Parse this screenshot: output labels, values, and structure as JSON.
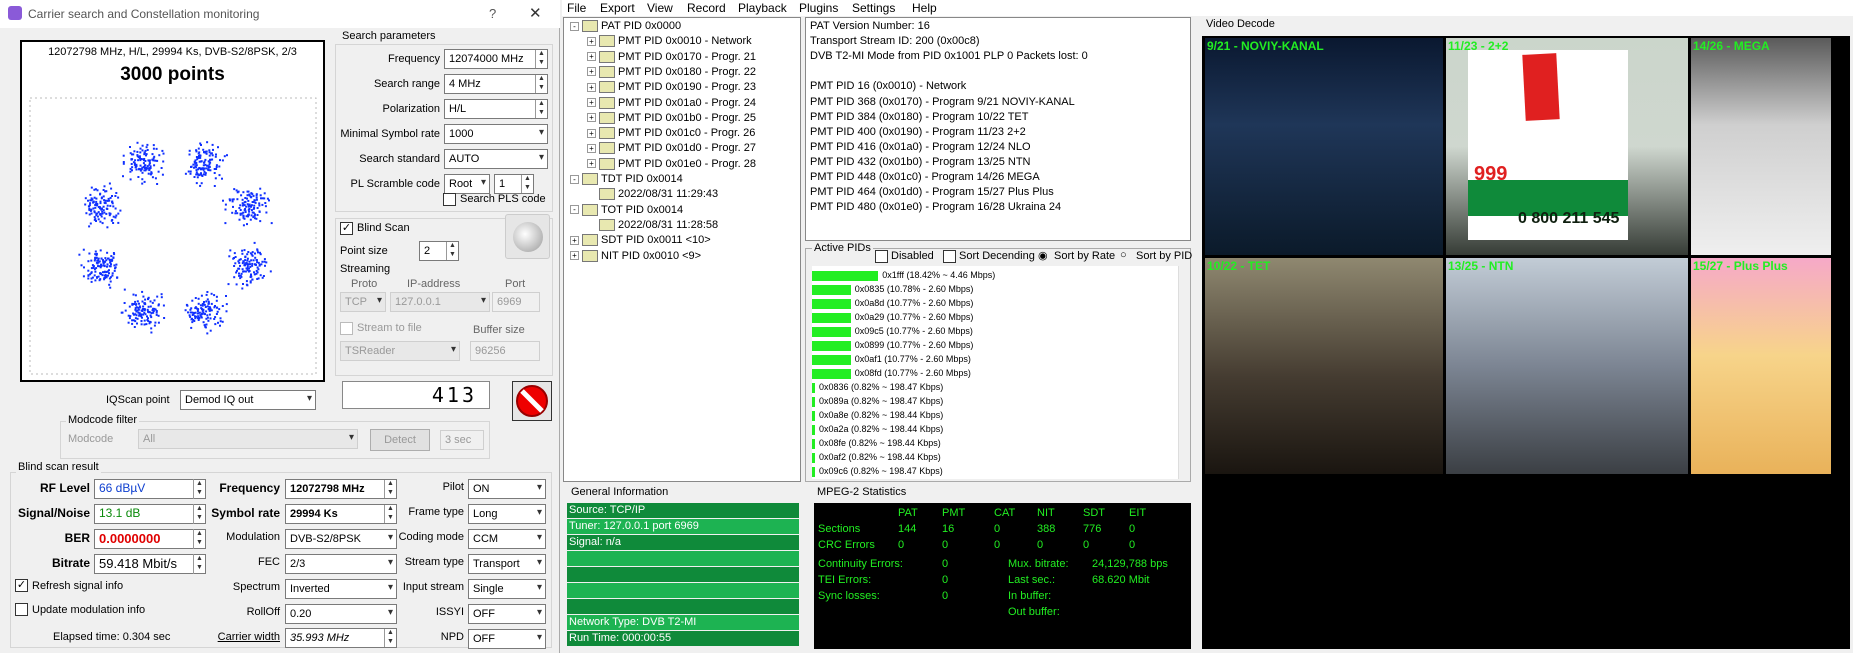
{
  "dialog": {
    "title": "Carrier search and Constellation monitoring",
    "help_glyph": "?",
    "close_glyph": "✕",
    "constellation": {
      "header": "12072798 MHz, H/L, 29994 Ks, DVB-S2/8PSK, 2/3",
      "points_label": "3000 points"
    },
    "search_params": {
      "group": "Search parameters",
      "frequency_label": "Frequency",
      "frequency": "12074000 MHz",
      "range_label": "Search range",
      "range": "4 MHz",
      "polarization_label": "Polarization",
      "polarization": "H/L",
      "min_sr_label": "Minimal Symbol rate",
      "min_sr": "1000",
      "standard_label": "Search standard",
      "standard": "AUTO",
      "pls_label": "PL Scramble code",
      "pls_mode": "Root",
      "pls_value": "1",
      "search_pls": "Search PLS code"
    },
    "blind_scan": "Blind Scan",
    "point_size_label": "Point size",
    "point_size": "2",
    "streaming": {
      "group": "Streaming",
      "proto_label": "Proto",
      "ip_label": "IP-address",
      "port_label": "Port",
      "proto": "TCP",
      "ip": "127.0.0.1",
      "port": "6969",
      "stream_to_file": "Stream to file",
      "buffer_label": "Buffer size",
      "reader": "TSReader",
      "buffer": "96256"
    },
    "counter": "413",
    "iqscan_label": "IQScan point",
    "iqscan": "Demod IQ out",
    "modcode": {
      "group": "Modcode filter",
      "label": "Modcode",
      "value": "All",
      "detect": "Detect",
      "sec": "3 sec"
    },
    "result": {
      "group": "Blind scan result",
      "rf_label": "RF Level",
      "rf": "66 dBµV",
      "sn_label": "Signal/Noise",
      "sn": "13.1 dB",
      "ber_label": "BER",
      "ber": "0.0000000",
      "bitrate_label": "Bitrate",
      "bitrate": "59.418 Mbit/s",
      "freq_label": "Frequency",
      "freq": "12072798 MHz",
      "sr_label": "Symbol rate",
      "sr": "29994 Ks",
      "mod_label": "Modulation",
      "mod": "DVB-S2/8PSK",
      "fec_label": "FEC",
      "fec": "2/3",
      "spectrum_label": "Spectrum",
      "spectrum": "Inverted",
      "rolloff_label": "RollOff",
      "rolloff": "0.20",
      "cw_label": "Carrier width",
      "cw": "35.993 MHz",
      "pilot_label": "Pilot",
      "pilot": "ON",
      "frame_label": "Frame type",
      "frame": "Long",
      "coding_label": "Coding mode",
      "coding": "CCM",
      "stype_label": "Stream type",
      "stype": "Transport",
      "istream_label": "Input stream",
      "istream": "Single",
      "issyi_label": "ISSYI",
      "issyi": "OFF",
      "npd_label": "NPD",
      "npd": "OFF",
      "refresh": "Refresh signal info",
      "update_mod": "Update modulation info",
      "elapsed": "Elapsed time: 0.304 sec"
    }
  },
  "menu": [
    "File",
    "Export",
    "View",
    "Record",
    "Playback",
    "Plugins",
    "Settings",
    "Help"
  ],
  "tree": [
    {
      "t": "PAT PID 0x0000",
      "lvl": 0,
      "exp": "-"
    },
    {
      "t": "PMT PID 0x0010 - Network",
      "lvl": 1,
      "exp": "+"
    },
    {
      "t": "PMT PID 0x0170 - Progr. 21",
      "lvl": 1,
      "exp": "+"
    },
    {
      "t": "PMT PID 0x0180 - Progr. 22",
      "lvl": 1,
      "exp": "+"
    },
    {
      "t": "PMT PID 0x0190 - Progr. 23",
      "lvl": 1,
      "exp": "+"
    },
    {
      "t": "PMT PID 0x01a0 - Progr. 24",
      "lvl": 1,
      "exp": "+"
    },
    {
      "t": "PMT PID 0x01b0 - Progr. 25",
      "lvl": 1,
      "exp": "+"
    },
    {
      "t": "PMT PID 0x01c0 - Progr. 26",
      "lvl": 1,
      "exp": "+"
    },
    {
      "t": "PMT PID 0x01d0 - Progr. 27",
      "lvl": 1,
      "exp": "+"
    },
    {
      "t": "PMT PID 0x01e0 - Progr. 28",
      "lvl": 1,
      "exp": "+"
    },
    {
      "t": "TDT PID 0x0014",
      "lvl": 0,
      "exp": "-"
    },
    {
      "t": "2022/08/31 11:29:43",
      "lvl": 1,
      "exp": ""
    },
    {
      "t": "TOT PID 0x0014",
      "lvl": 0,
      "exp": "-"
    },
    {
      "t": "2022/08/31 11:28:58",
      "lvl": 1,
      "exp": ""
    },
    {
      "t": "SDT PID 0x0011 <10>",
      "lvl": 0,
      "exp": "+"
    },
    {
      "t": "NIT PID 0x0010 <9>",
      "lvl": 0,
      "exp": "+"
    }
  ],
  "info_lines": [
    "PAT Version Number: 16",
    "Transport Stream ID: 200 (0x00c8)",
    "DVB T2-MI Mode from PID 0x1001 PLP 0 Packets lost: 0",
    "",
    "PMT PID 16 (0x0010) - Network",
    "PMT PID 368 (0x0170) - Program 9/21 NOVIY-KANAL",
    "PMT PID 384 (0x0180) - Program 10/22 TET",
    "PMT PID 400 (0x0190) - Program 11/23 2+2",
    "PMT PID 416 (0x01a0) - Program 12/24 NLO",
    "PMT PID 432 (0x01b0) - Program 13/25 NTN",
    "PMT PID 448 (0x01c0) - Program 14/26 MEGA",
    "PMT PID 464 (0x01d0) - Program 15/27 Plus Plus",
    "PMT PID 480 (0x01e0) - Program 16/28 Ukraina 24"
  ],
  "active_pids": {
    "group": "Active PIDs",
    "disabled": "Disabled",
    "sort_desc": "Sort Decending",
    "sort_rate": "Sort by Rate",
    "sort_pid": "Sort by PID",
    "rows": [
      {
        "t": "0x1fff (18.42% ~ 4.46 Mbps)",
        "pct": 18.42
      },
      {
        "t": "0x0835 (10.78% - 2.60 Mbps)",
        "pct": 10.78
      },
      {
        "t": "0x0a8d (10.77% - 2.60 Mbps)",
        "pct": 10.77
      },
      {
        "t": "0x0a29 (10.77% - 2.60 Mbps)",
        "pct": 10.77
      },
      {
        "t": "0x09c5 (10.77% - 2.60 Mbps)",
        "pct": 10.77
      },
      {
        "t": "0x0899 (10.77% - 2.60 Mbps)",
        "pct": 10.77
      },
      {
        "t": "0x0af1 (10.77% - 2.60 Mbps)",
        "pct": 10.77
      },
      {
        "t": "0x08fd (10.77% - 2.60 Mbps)",
        "pct": 10.77
      },
      {
        "t": "0x0836 (0.82% ~ 198.47 Kbps)",
        "pct": 0.82
      },
      {
        "t": "0x089a (0.82% ~ 198.47 Kbps)",
        "pct": 0.82
      },
      {
        "t": "0x0a8e (0.82% ~ 198.44 Kbps)",
        "pct": 0.82
      },
      {
        "t": "0x0a2a (0.82% ~ 198.44 Kbps)",
        "pct": 0.82
      },
      {
        "t": "0x08fe (0.82% ~ 198.44 Kbps)",
        "pct": 0.82
      },
      {
        "t": "0x0af2 (0.82% ~ 198.44 Kbps)",
        "pct": 0.82
      },
      {
        "t": "0x09c6 (0.82% ~ 198.47 Kbps)",
        "pct": 0.82
      }
    ]
  },
  "general": {
    "group": "General Information",
    "source": "Source: TCP/IP",
    "tuner": "Tuner: 127.0.0.1 port 6969",
    "signal": "Signal: n/a",
    "network": "Network Type: DVB T2-MI",
    "runtime": "Run Time: 000:00:55"
  },
  "mpeg": {
    "group": "MPEG-2 Statistics",
    "cols": [
      "PAT",
      "PMT",
      "CAT",
      "NIT",
      "SDT",
      "EIT"
    ],
    "sections_label": "Sections",
    "sections": [
      "144",
      "16",
      "0",
      "388",
      "776",
      "0"
    ],
    "crc_label": "CRC Errors",
    "crc": [
      "0",
      "0",
      "0",
      "0",
      "0",
      "0"
    ],
    "cont_label": "Continuity Errors:",
    "cont": "0",
    "tei_label": "TEI Errors:",
    "tei": "0",
    "sync_label": "Sync losses:",
    "sync": "0",
    "mux_label": "Mux. bitrate:",
    "mux": "24,129,788 bps",
    "last_label": "Last sec.:",
    "last": "68.620 Mbit",
    "inbuf_label": "In buffer:",
    "outbuf_label": "Out buffer:"
  },
  "video": {
    "group": "Video Decode",
    "tiles": [
      "9/21 - NOVIY-KANAL",
      "11/23 - 2+2",
      "14/26 - MEGA",
      "10/22 - TET",
      "13/25 - NTN",
      "15/27 - Plus Plus"
    ],
    "ad_price": "999",
    "ad_phone": "0 800 211 545"
  },
  "colors": {
    "accent_green": "#22ee22",
    "led_red": "#e00000",
    "value_blue": "#1040d0",
    "dot_blue": "#1030ff"
  }
}
